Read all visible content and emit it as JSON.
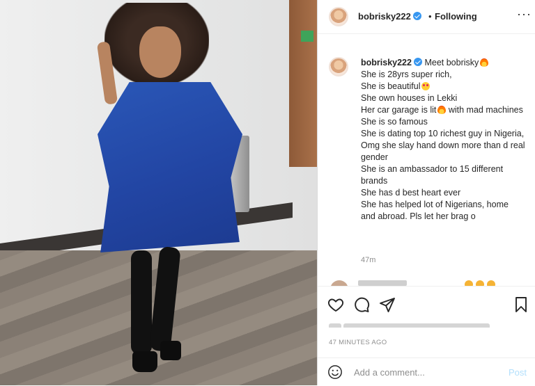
{
  "header": {
    "username": "bobrisky222",
    "separator": "•",
    "follow_state": "Following",
    "more": "···"
  },
  "caption": {
    "username": "bobrisky222",
    "lines": [
      "Meet bobrisky",
      "She is 28yrs super rich,",
      "She is beautiful",
      "She own houses in Lekki",
      "Her car garage is lit",
      "with mad machines",
      "She is so famous",
      "She is dating top 10 richest guy in Nigeria,",
      "Omg she slay hand down more than d real gender",
      "She is an ambassador to 15 different brands",
      "She has d best heart ever",
      "She has helped lot of Nigerians, home and abroad. Pls let her brag o"
    ],
    "age": "47m"
  },
  "footer": {
    "time_ago": "47 MINUTES AGO",
    "comment_placeholder": "Add a comment...",
    "post_label": "Post"
  },
  "icons": {
    "like": "heart-icon",
    "comment": "comment-icon",
    "share": "share-icon",
    "save": "bookmark-icon",
    "emoji": "smiley-icon",
    "verified": "verified-badge-icon"
  },
  "colors": {
    "verified": "#3897f0",
    "post_disabled": "#b2dffc",
    "muted": "#8e8e8e",
    "dress": "#2245a3"
  }
}
